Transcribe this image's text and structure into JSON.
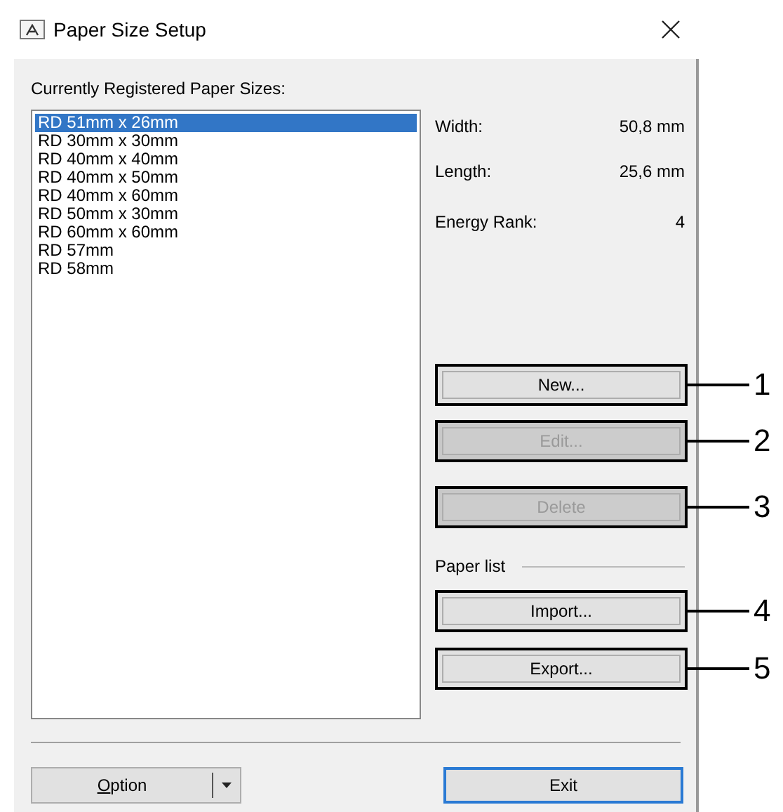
{
  "window": {
    "title": "Paper Size Setup"
  },
  "list_label": "Currently Registered Paper Sizes:",
  "paper_sizes": [
    {
      "label": "RD 51mm x 26mm",
      "selected": true
    },
    {
      "label": "RD 30mm x 30mm",
      "selected": false
    },
    {
      "label": "RD 40mm x 40mm",
      "selected": false
    },
    {
      "label": "RD 40mm x 50mm",
      "selected": false
    },
    {
      "label": "RD 40mm x 60mm",
      "selected": false
    },
    {
      "label": "RD 50mm x 30mm",
      "selected": false
    },
    {
      "label": "RD 60mm x 60mm",
      "selected": false
    },
    {
      "label": "RD 57mm",
      "selected": false
    },
    {
      "label": "RD 58mm",
      "selected": false
    }
  ],
  "details": [
    {
      "label": "Width:",
      "value": "50,8 mm"
    },
    {
      "label": "Length:",
      "value": "25,6 mm"
    },
    {
      "label": "Energy Rank:",
      "value": "4"
    }
  ],
  "buttons": [
    {
      "label": "New...",
      "disabled": false,
      "callout": "1"
    },
    {
      "label": "Edit...",
      "disabled": true,
      "callout": "2"
    },
    {
      "label": "Delete",
      "disabled": true,
      "callout": "3"
    }
  ],
  "paper_list_label": "Paper list",
  "paper_list_buttons": [
    {
      "label": "Import...",
      "disabled": false,
      "callout": "4"
    },
    {
      "label": "Export...",
      "disabled": false,
      "callout": "5"
    }
  ],
  "footer": {
    "option_button": "Option",
    "exit_button": "Exit"
  }
}
